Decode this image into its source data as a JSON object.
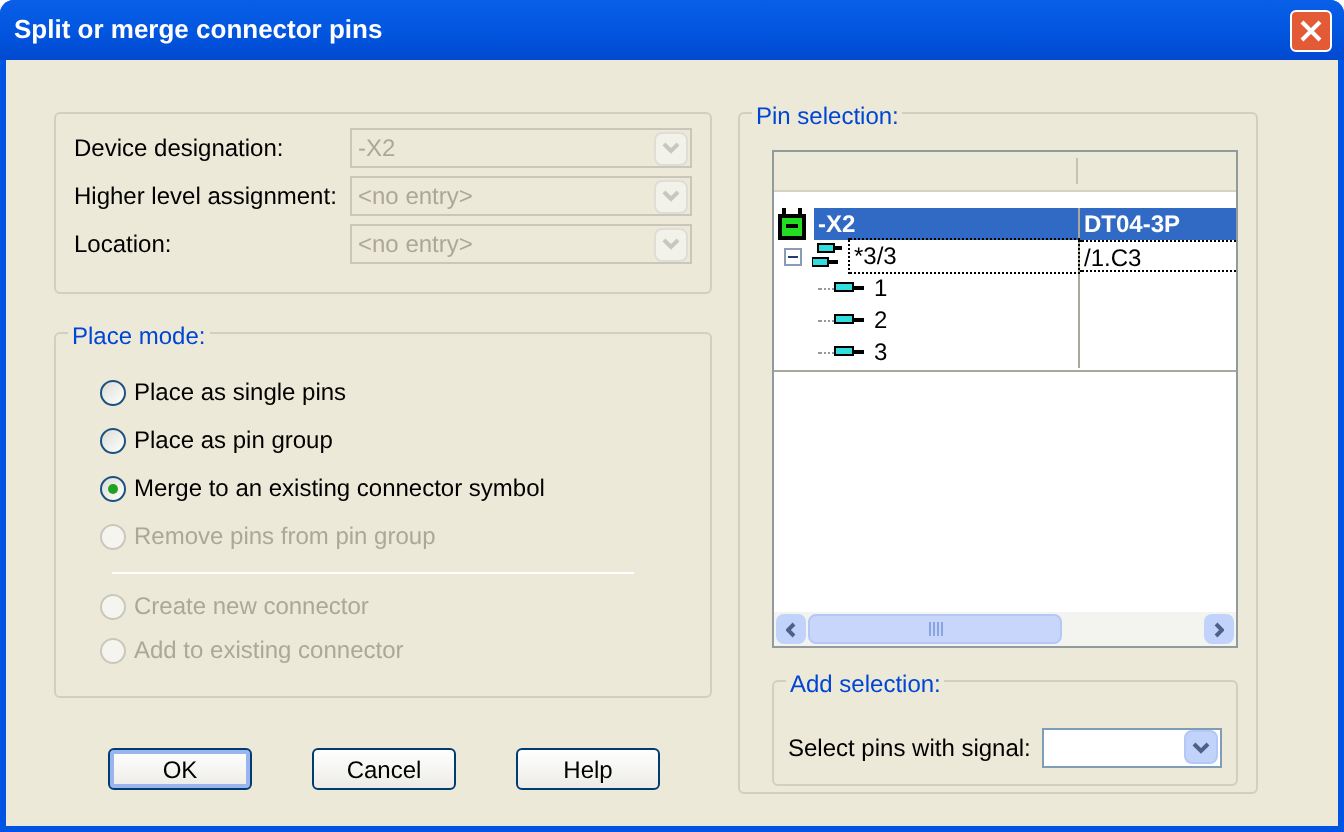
{
  "window": {
    "title": "Split or merge connector pins"
  },
  "device_fields": [
    {
      "label": "Device designation:",
      "value": "-X2",
      "disabled": true
    },
    {
      "label": "Higher level assignment:",
      "value": "<no entry>",
      "disabled": true
    },
    {
      "label": "Location:",
      "value": "<no entry>",
      "disabled": true
    }
  ],
  "place_mode": {
    "title": "Place mode:",
    "options": [
      {
        "label": "Place as single pins",
        "selected": false,
        "disabled": false
      },
      {
        "label": "Place as pin group",
        "selected": false,
        "disabled": false
      },
      {
        "label": "Merge to an existing connector symbol",
        "selected": true,
        "disabled": false
      },
      {
        "label": "Remove pins from pin group",
        "selected": false,
        "disabled": true
      }
    ],
    "connector_options": [
      {
        "label": "Create new connector",
        "selected": false,
        "disabled": true
      },
      {
        "label": "Add to existing connector",
        "selected": false,
        "disabled": true
      }
    ]
  },
  "pin_selection": {
    "title": "Pin selection:",
    "tree": [
      {
        "kind": "device",
        "name": "-X2",
        "column_2": "DT04-3P",
        "selected": true,
        "focused": false,
        "children": [
          {
            "kind": "group",
            "name": "*3/3",
            "column_2": "/1.C3",
            "selected": false,
            "focused": true,
            "expanded": true,
            "children": [
              {
                "kind": "pin",
                "name": "1",
                "selected": false,
                "focused": false
              },
              {
                "kind": "pin",
                "name": "2",
                "selected": false,
                "focused": false
              },
              {
                "kind": "pin",
                "name": "3",
                "selected": false,
                "focused": false
              }
            ]
          }
        ]
      }
    ]
  },
  "add_selection": {
    "title": "Add selection:",
    "label": "Select pins with signal:"
  },
  "buttons": [
    {
      "label": "OK",
      "default": true
    },
    {
      "label": "Cancel",
      "default": false
    },
    {
      "label": "Help",
      "default": false
    }
  ]
}
